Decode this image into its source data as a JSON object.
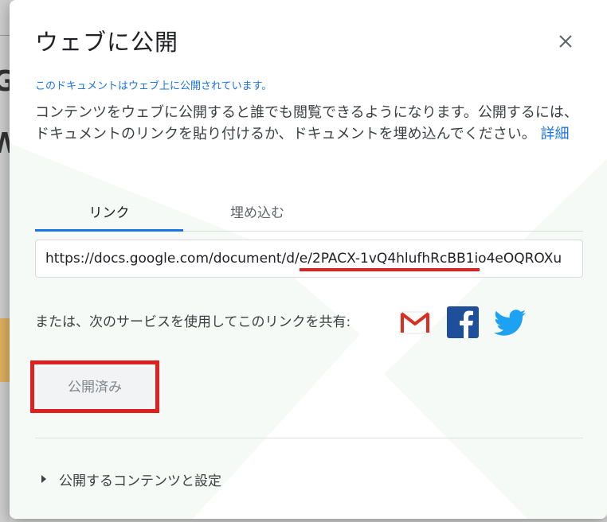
{
  "backdrop": {
    "letters": [
      "G",
      "W"
    ]
  },
  "dialog": {
    "title": "ウェブに公開",
    "close_icon": "close-icon",
    "status": "このドキュメントはウェブ上に公開されています。",
    "description": "コンテンツをウェブに公開すると誰でも閲覧できるようになります。公開するには、ドキュメントのリンクを貼り付けるか、ドキュメントを埋め込んでください。",
    "learn_more": "詳細",
    "tabs": [
      {
        "label": "リンク",
        "active": true
      },
      {
        "label": "埋め込む",
        "active": false
      }
    ],
    "url": "https://docs.google.com/document/d/e/2PACX-1vQ4hlufhRcBB1io4eOQROXu",
    "share_label": "または、次のサービスを使用してこのリンクを共有:",
    "share_services": [
      {
        "name": "Gmail",
        "icon": "gmail-icon",
        "color": "#d93025"
      },
      {
        "name": "Facebook",
        "icon": "facebook-icon",
        "color": "#1d4f9a"
      },
      {
        "name": "Twitter",
        "icon": "twitter-icon",
        "color": "#1da1f2"
      }
    ],
    "published_button": "公開済み",
    "settings_expander": "公開するコンテンツと設定"
  },
  "colors": {
    "accent": "#1a73e8",
    "highlight_red": "#e0201e"
  }
}
